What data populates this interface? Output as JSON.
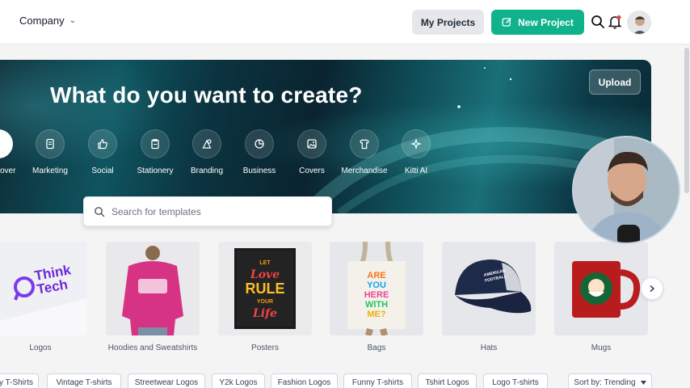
{
  "header": {
    "company_label": "Company",
    "my_projects_label": "My Projects",
    "new_project_label": "New Project"
  },
  "hero": {
    "title": "What do you want to create?",
    "upload_label": "Upload",
    "partial_category_label": "over",
    "categories": [
      {
        "label": "Marketing",
        "icon": "marketing-icon"
      },
      {
        "label": "Social",
        "icon": "thumbs-up-icon"
      },
      {
        "label": "Stationery",
        "icon": "stationery-icon"
      },
      {
        "label": "Branding",
        "icon": "branding-icon"
      },
      {
        "label": "Business",
        "icon": "pie-chart-icon"
      },
      {
        "label": "Covers",
        "icon": "image-icon"
      },
      {
        "label": "Merchandise",
        "icon": "tshirt-icon"
      },
      {
        "label": "Kitti AI",
        "icon": "sparkle-icon"
      }
    ]
  },
  "search": {
    "placeholder": "Search for templates"
  },
  "products": [
    {
      "label": "Logos",
      "thumb_text": [
        "Think",
        "Tech"
      ]
    },
    {
      "label": "Hoodies and Sweatshirts"
    },
    {
      "label": "Posters",
      "thumb_text": [
        "LET",
        "Love",
        "RULE",
        "YOUR",
        "Life"
      ]
    },
    {
      "label": "Bags",
      "thumb_text": [
        "ARE",
        "YOU",
        "HERE",
        "WITH",
        "ME?"
      ]
    },
    {
      "label": "Hats",
      "thumb_text": [
        "AMERICAN",
        "FOOTBALL"
      ]
    },
    {
      "label": "Mugs"
    }
  ],
  "chips": [
    "y T-Shirts",
    "Vintage T-shirts",
    "Streetwear Logos",
    "Y2k Logos",
    "Fashion Logos",
    "Funny T-shirts",
    "Tshirt Logos",
    "Logo T-shirts"
  ],
  "sort_label": "Sort by: Trending",
  "colors": {
    "accent": "#10b28c",
    "hero_dark": "#0a2a35",
    "hero_teal": "#1a6f78"
  }
}
